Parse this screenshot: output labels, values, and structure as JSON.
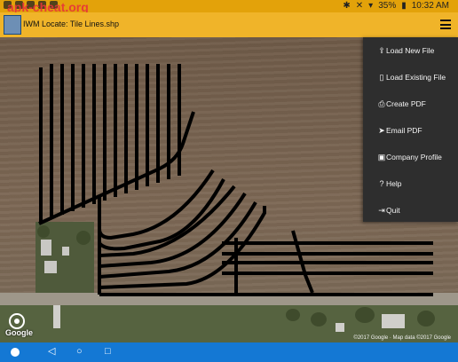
{
  "status_bar": {
    "watermark": "apk-cheat.org",
    "battery": "35%",
    "time": "10:32 AM"
  },
  "app_bar": {
    "title": "IWM Locate: Tile Lines.shp"
  },
  "menu": {
    "items": [
      {
        "label": "Load New File",
        "icon": "upload-icon"
      },
      {
        "label": "Load Existing File",
        "icon": "file-icon"
      },
      {
        "label": "Create PDF",
        "icon": "print-icon"
      },
      {
        "label": "Email PDF",
        "icon": "send-icon"
      },
      {
        "label": "Company Profile",
        "icon": "image-icon"
      },
      {
        "label": "Help",
        "icon": "help-icon"
      },
      {
        "label": "Quit",
        "icon": "exit-icon"
      }
    ]
  },
  "map": {
    "google_label": "Google",
    "copyright": "©2017 Google · Map data ©2017 Google"
  },
  "colors": {
    "status_bar": "#e3a20a",
    "app_bar": "#f0b429",
    "menu_bg": "#2e2e2e",
    "nav_bar": "#1478d4",
    "tile_line": "#000000"
  }
}
